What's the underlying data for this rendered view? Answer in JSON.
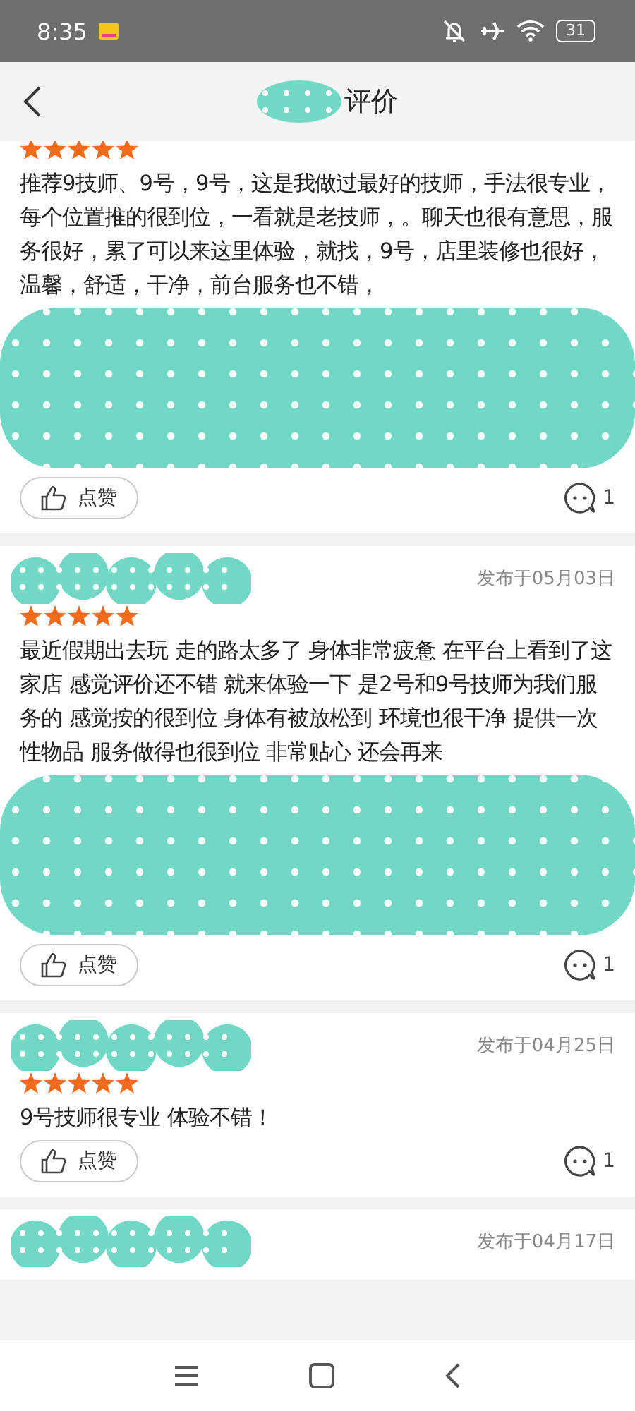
{
  "status_bar": {
    "time": "8:35",
    "battery": "31"
  },
  "header": {
    "title": "评价"
  },
  "reviews": [
    {
      "stars": 5,
      "text": "推荐9技师、9号，9号，这是我做过最好的技师，手法很专业，每个位置推的很到位，一看就是老技师，。聊天也很有意思，服务很好，累了可以来这里体验，就找，9号，店里装修也很好，温馨，舒适，干净，前台服务也不错，",
      "photos_covered": true,
      "like_label": "点赞",
      "comment_count": "1"
    },
    {
      "name_covered": true,
      "date": "发布于05月03日",
      "stars": 5,
      "text": "最近假期出去玩 走的路太多了 身体非常疲惫 在平台上看到了这家店 感觉评价还不错 就来体验一下 是2号和9号技师为我们服务的 感觉按的很到位 身体有被放松到 环境也很干净 提供一次性物品 服务做得也很到位 非常贴心 还会再来",
      "photos_covered": true,
      "like_label": "点赞",
      "comment_count": "1"
    },
    {
      "name_covered": true,
      "date": "发布于04月25日",
      "stars": 5,
      "text": "9号技师很专业 体验不错！",
      "like_label": "点赞",
      "comment_count": "1"
    },
    {
      "name_covered": true,
      "date": "发布于04月17日"
    }
  ]
}
